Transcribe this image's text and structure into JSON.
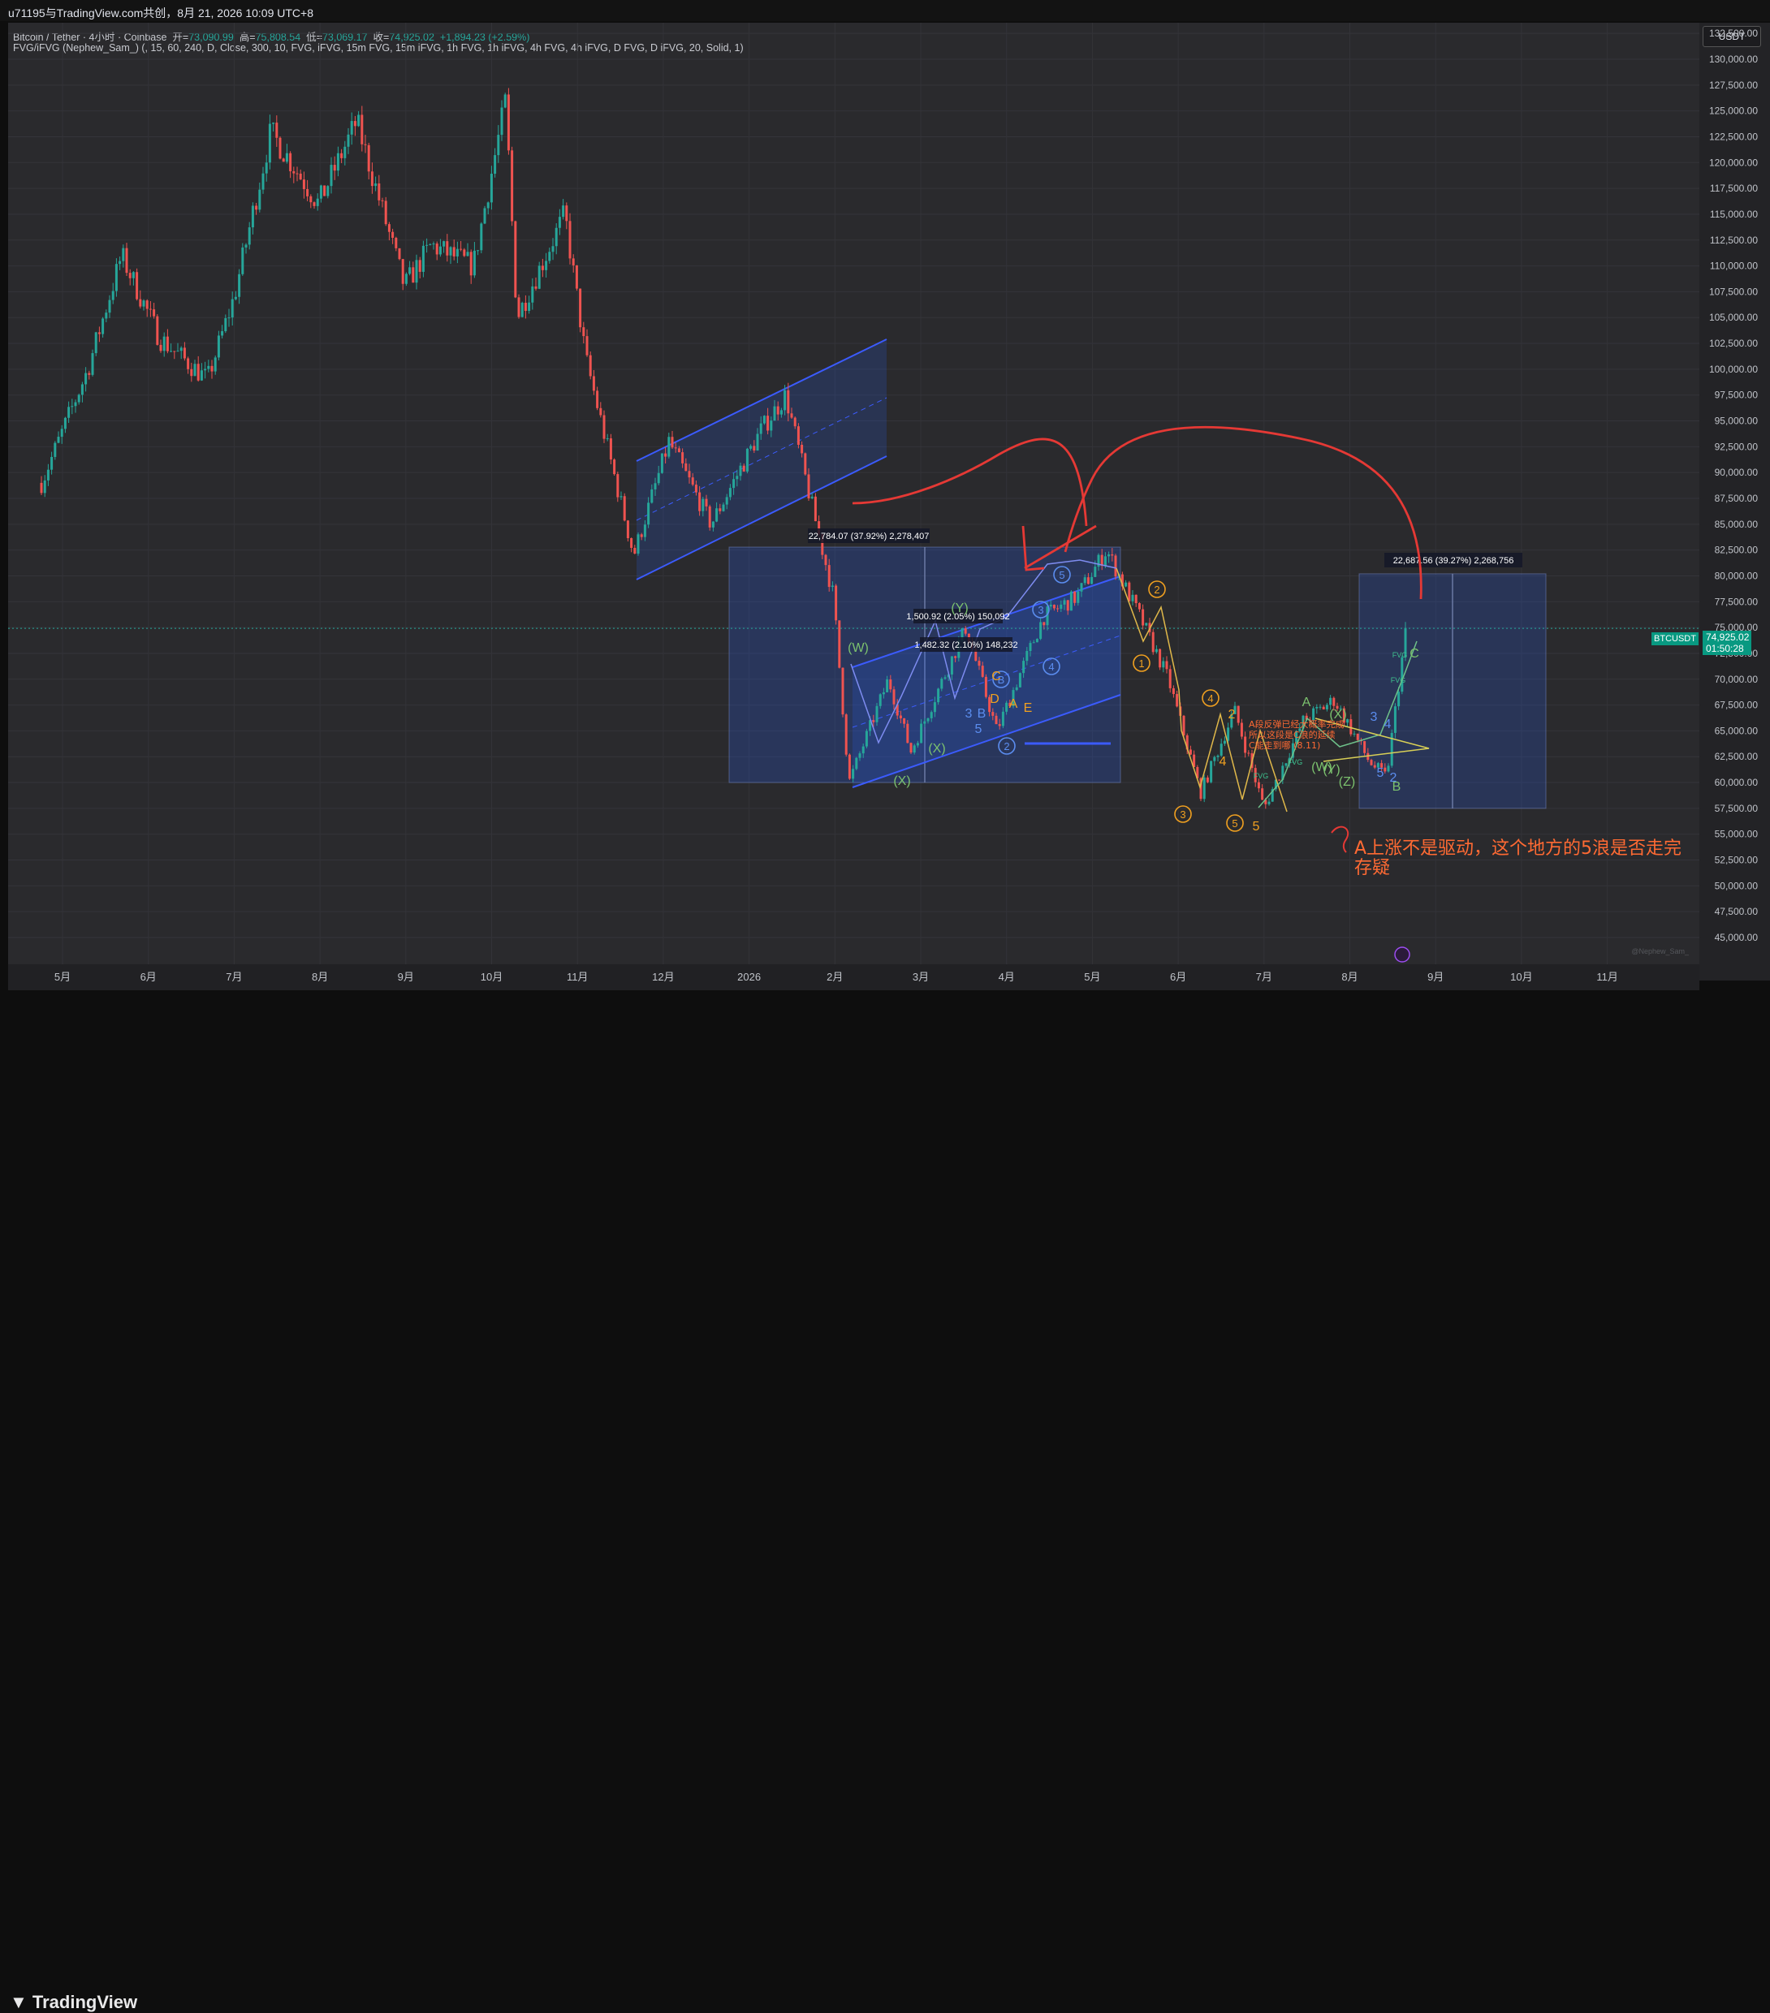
{
  "header": {
    "share_text": "u71195与TradingView.com共创，8月 21, 2026 10:09 UTC+8"
  },
  "legend": {
    "symbol": "Bitcoin / Tether · 4小时 · Coinbase",
    "open_label": "开=",
    "open_value": "73,090.99",
    "high_label": "高=",
    "high_value": "75,808.54",
    "low_label": "低=",
    "low_value": "73,069.17",
    "close_label": "收=",
    "close_value": "74,925.02",
    "change": "+1,894.23 (+2.59%)",
    "indicator": "FVG/iFVG (Nephew_Sam_) (, 15, 60, 240, D, Close, 300, 10, FVG, iFVG, 15m FVG, 15m iFVG, 1h FVG, 1h iFVG, 4h FVG, 4h iFVG, D FVG, D iFVG, 20, Solid, 1)"
  },
  "price_scale": {
    "currency": "USDT",
    "symbol_tag": "BTCUSDT",
    "last_price": "74,925.02",
    "countdown": "01:50:28"
  },
  "footer": {
    "brand": "TradingView",
    "watermark": "@Nephew_Sam_"
  },
  "colors": {
    "background": "#2a2a2d",
    "up": "#26a69a",
    "down": "#ef5350",
    "channel": "#3b5bfd",
    "annotation": "#e53935",
    "wave_orange": "#f0a020",
    "wave_green": "#7cc26e",
    "wave_blue": "#5b8def"
  },
  "chart_data": {
    "type": "candlestick",
    "symbol": "BTCUSDT",
    "timeframe": "4小时",
    "yaxis": {
      "ylim": [
        43000,
        134000
      ],
      "ticks": [
        45000,
        47500,
        50000,
        52500,
        55000,
        57500,
        60000,
        62500,
        65000,
        67500,
        70000,
        72500,
        75000,
        77500,
        80000,
        82500,
        85000,
        87500,
        90000,
        92500,
        95000,
        97500,
        100000,
        102500,
        105000,
        107500,
        110000,
        112500,
        115000,
        117500,
        120000,
        122500,
        125000,
        127500,
        130000,
        132500
      ],
      "tick_labels": [
        "45,000.00",
        "47,500.00",
        "50,000.00",
        "52,500.00",
        "55,000.00",
        "57,500.00",
        "60,000.00",
        "62,500.00",
        "65,000.00",
        "67,500.00",
        "70,000.00",
        "72,500.00",
        "75,000.00",
        "77,500.00",
        "80,000.00",
        "82,500.00",
        "85,000.00",
        "87,500.00",
        "90,000.00",
        "92,500.00",
        "95,000.00",
        "97,500.00",
        "100,000.00",
        "102,500.00",
        "105,000.00",
        "107,500.00",
        "110,000.00",
        "112,500.00",
        "115,000.00",
        "117,500.00",
        "120,000.00",
        "122,500.00",
        "125,000.00",
        "127,500.00",
        "130,000.00",
        "132,500.00"
      ]
    },
    "xaxis": {
      "labels": [
        "5月",
        "6月",
        "7月",
        "8月",
        "9月",
        "10月",
        "11月",
        "12月",
        "2026",
        "2月",
        "3月",
        "4月",
        "5月",
        "6月",
        "7月",
        "8月",
        "9月",
        "10月",
        "11月"
      ],
      "months": [
        "2025-05",
        "2025-06",
        "2025-07",
        "2025-08",
        "2025-09",
        "2025-10",
        "2025-11",
        "2025-12",
        "2026-01",
        "2026-02",
        "2026-03",
        "2026-04",
        "2026-05",
        "2026-06",
        "2026-07",
        "2026-08",
        "2026-09",
        "2026-10",
        "2026-11"
      ]
    },
    "price_path": [
      [
        "2025-04-24",
        89000
      ],
      [
        "2025-05-10",
        100000
      ],
      [
        "2025-05-22",
        111000
      ],
      [
        "2025-06-05",
        103000
      ],
      [
        "2025-06-22",
        99000
      ],
      [
        "2025-07-01",
        107000
      ],
      [
        "2025-07-14",
        123000
      ],
      [
        "2025-07-31",
        116000
      ],
      [
        "2025-08-14",
        124000
      ],
      [
        "2025-08-31",
        108000
      ],
      [
        "2025-09-10",
        112000
      ],
      [
        "2025-09-25",
        110000
      ],
      [
        "2025-10-06",
        126000
      ],
      [
        "2025-10-10",
        105000
      ],
      [
        "2025-10-27",
        115000
      ],
      [
        "2025-11-04",
        101000
      ],
      [
        "2025-11-21",
        82000
      ],
      [
        "2025-12-03",
        93000
      ],
      [
        "2025-12-18",
        85000
      ],
      [
        "2026-01-05",
        94000
      ],
      [
        "2026-01-14",
        97500
      ],
      [
        "2026-01-31",
        78000
      ],
      [
        "2026-02-06",
        60000
      ],
      [
        "2026-02-20",
        70000
      ],
      [
        "2026-02-28",
        63000
      ],
      [
        "2026-03-17",
        75000
      ],
      [
        "2026-03-28",
        65000
      ],
      [
        "2026-04-14",
        76000
      ],
      [
        "2026-04-26",
        78000
      ],
      [
        "2026-05-06",
        82500
      ],
      [
        "2026-05-18",
        76000
      ],
      [
        "2026-05-28",
        70000
      ],
      [
        "2026-06-09",
        59000
      ],
      [
        "2026-06-21",
        67000
      ],
      [
        "2026-07-01",
        57500
      ],
      [
        "2026-07-15",
        66000
      ],
      [
        "2026-07-26",
        68000
      ],
      [
        "2026-08-08",
        62000
      ],
      [
        "2026-08-14",
        60500
      ],
      [
        "2026-08-21",
        74925
      ]
    ],
    "last_price": 74925.02,
    "measurements": [
      {
        "label": "22,784.07 (37.92%) 2,278,407",
        "from": 60000,
        "to": 82784
      },
      {
        "label": "1,500.92 (2.05%) 150,092"
      },
      {
        "label": "1,482.32 (2.10%) 148,232"
      },
      {
        "label": "22,687.56 (39.27%) 2,268,756",
        "from": 57500,
        "to": 80200
      }
    ],
    "wave_labels": {
      "blue": [
        "1",
        "2",
        "3",
        "4",
        "5",
        "3",
        "5",
        "B",
        "2",
        "3",
        "4",
        "5",
        "2"
      ],
      "orange": [
        "1",
        "2",
        "3",
        "4",
        "5",
        "2",
        "4",
        "5",
        "D",
        "C",
        "A",
        "E"
      ],
      "green": [
        "(W)",
        "(X)",
        "(X)",
        "(Y)",
        "(Z)",
        "(Y)",
        "(W)",
        "(X)",
        "A",
        "B",
        "C"
      ]
    },
    "annotations": {
      "main": "A上涨不是驱动，这个地方的5浪是否走完",
      "main_line2": "存疑",
      "small": [
        "A段反弹已经大概率完成",
        "所以这段是C浪的延续",
        "C能走到哪 (8.11)"
      ],
      "fvg_label": "FVG"
    }
  }
}
